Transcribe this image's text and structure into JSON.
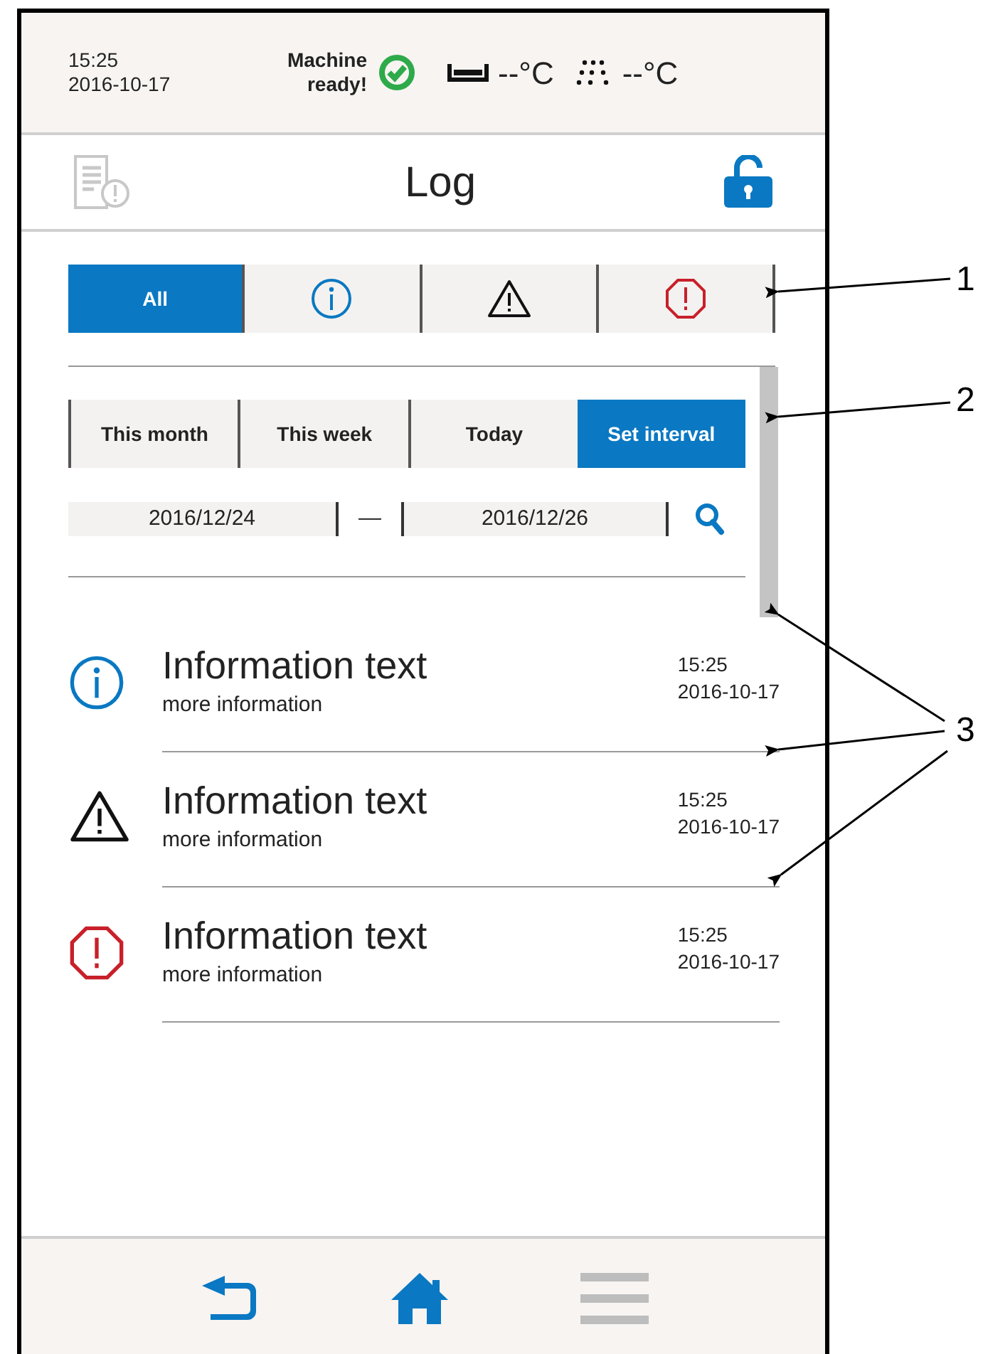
{
  "status_bar": {
    "time": "15:25",
    "date": "2016-10-17",
    "machine_status": "Machine ready!",
    "temperatures": [
      {
        "kind": "bath",
        "reading": "--°C"
      },
      {
        "kind": "shower",
        "reading": "--°C"
      }
    ]
  },
  "header": {
    "title": "Log"
  },
  "filter_tabs": [
    {
      "kind": "all",
      "label": "All",
      "selected": true
    },
    {
      "kind": "info",
      "selected": false
    },
    {
      "kind": "warning",
      "selected": false
    },
    {
      "kind": "error",
      "selected": false
    }
  ],
  "period_tabs": [
    {
      "label": "This month",
      "selected": false
    },
    {
      "label": "This week",
      "selected": false
    },
    {
      "label": "Today",
      "selected": false
    },
    {
      "label": "Set interval",
      "selected": true
    }
  ],
  "date_range": {
    "from": "2016/12/24",
    "separator": "—",
    "to": "2016/12/26"
  },
  "entries": [
    {
      "kind": "info",
      "title": "Information text",
      "detail": "more information",
      "time": "15:25",
      "date": "2016-10-17"
    },
    {
      "kind": "warning",
      "title": "Information text",
      "detail": "more information",
      "time": "15:25",
      "date": "2016-10-17"
    },
    {
      "kind": "error",
      "title": "Information text",
      "detail": "more information",
      "time": "15:25",
      "date": "2016-10-17"
    }
  ],
  "callouts": [
    {
      "label": "1"
    },
    {
      "label": "2"
    },
    {
      "label": "3"
    }
  ]
}
